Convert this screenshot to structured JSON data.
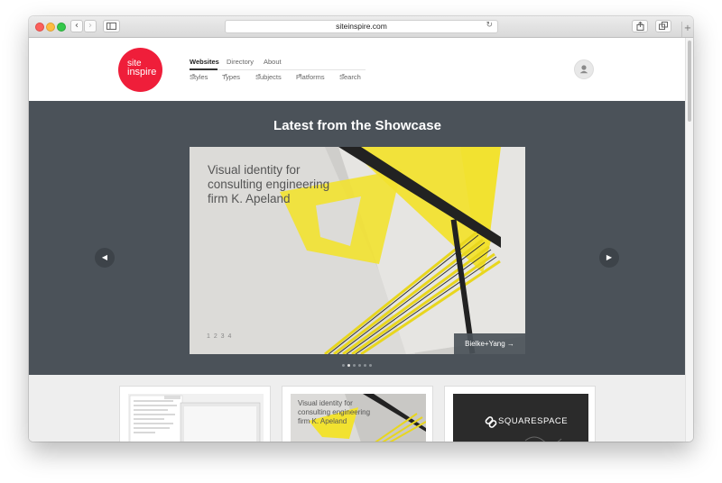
{
  "browser": {
    "url": "siteinspire.com",
    "back_icon": "‹",
    "forward_icon": "›",
    "reload_icon": "↻",
    "new_tab_icon": "+"
  },
  "header": {
    "logo_line1": "site",
    "logo_line2": "inspire",
    "nav_top": [
      "Websites",
      "Directory",
      "About"
    ],
    "nav_sub": [
      "Styles",
      "Types",
      "Subjects",
      "Platforms",
      "Search"
    ],
    "caret": "▼"
  },
  "showcase": {
    "title": "Latest from the Showcase",
    "caption": "Visual identity for\nconsulting engineering\nfirm K. Apeland",
    "slide_numbers": "1 2 3 4",
    "credit": "Bielke+Yang →",
    "prev_icon": "◀",
    "next_icon": "▶",
    "pager_count": 6,
    "pager_active": 1
  },
  "cards": [
    {
      "name": "card-1"
    },
    {
      "name": "card-2",
      "caption": "Visual identity for\nconsulting engineering\nfirm K. Apeland"
    },
    {
      "name": "card-3",
      "brand": "SQUARESPACE"
    }
  ],
  "colors": {
    "logo_red": "#ef1e3a",
    "showcase_bg": "#4b5259",
    "accent_yellow": "#f2e230"
  }
}
